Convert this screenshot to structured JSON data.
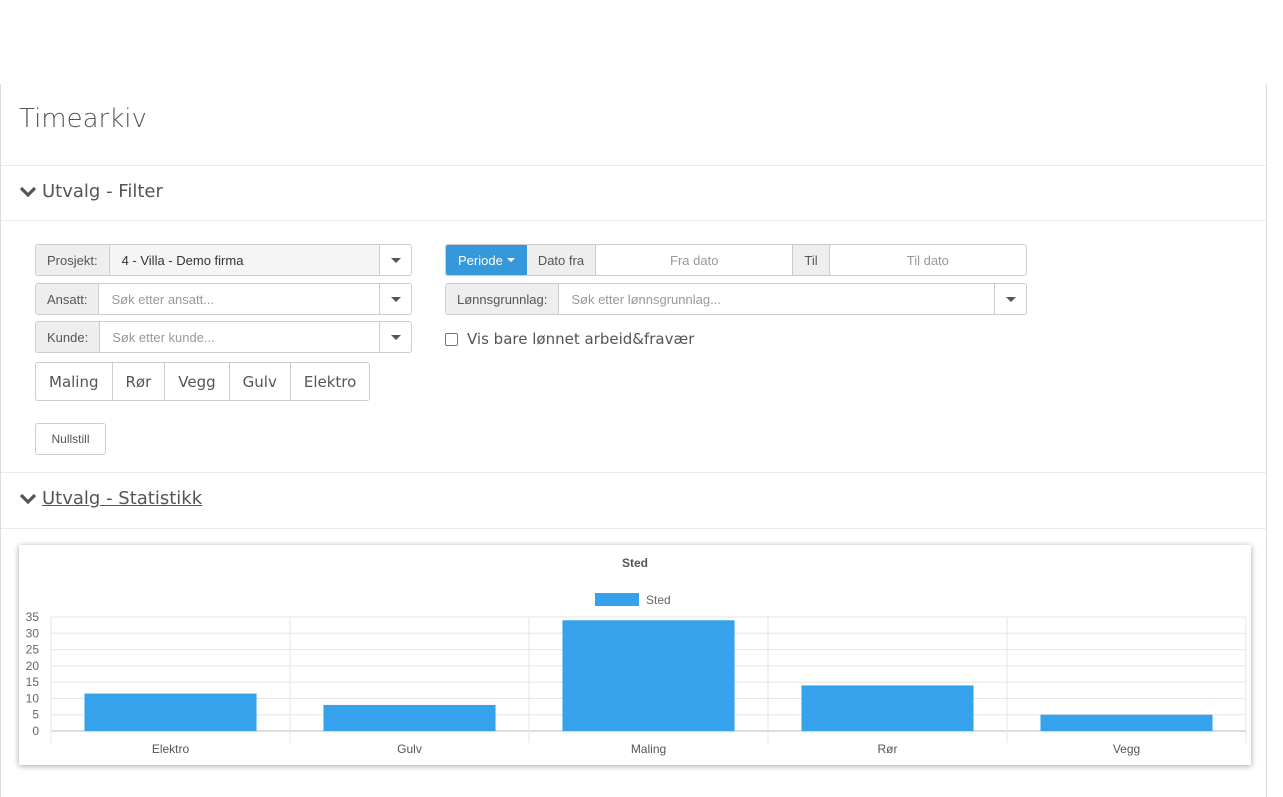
{
  "page": {
    "title": "Timearkiv"
  },
  "sections": {
    "filter": {
      "label": "Utvalg - Filter"
    },
    "stats": {
      "label": "Utvalg - Statistikk"
    }
  },
  "filters": {
    "prosjekt": {
      "label": "Prosjekt:",
      "value": "4 - Villa - Demo firma"
    },
    "ansatt": {
      "label": "Ansatt:",
      "placeholder": "Søk etter ansatt..."
    },
    "kunde": {
      "label": "Kunde:",
      "placeholder": "Søk etter kunde..."
    },
    "periode": {
      "button": "Periode",
      "from_label": "Dato fra",
      "from_placeholder": "Fra dato",
      "to_label": "Til",
      "to_placeholder": "Til dato"
    },
    "lonnsgrunnlag": {
      "label": "Lønnsgrunnlag:",
      "placeholder": "Søk etter lønnsgrunnlag..."
    },
    "paid_only": {
      "label": "Vis bare lønnet arbeid&fravær",
      "checked": false
    },
    "categories": [
      "Maling",
      "Rør",
      "Vegg",
      "Gulv",
      "Elektro"
    ],
    "reset": "Nullstill"
  },
  "colors": {
    "accent": "#3498db",
    "bar": "#36a2eb"
  },
  "chart_data": {
    "type": "bar",
    "title": "Sted",
    "categories": [
      "Elektro",
      "Gulv",
      "Maling",
      "Rør",
      "Vegg"
    ],
    "series": [
      {
        "name": "Sted",
        "values": [
          11.5,
          8,
          34,
          14,
          5
        ]
      }
    ],
    "ylim": [
      0,
      35
    ],
    "yticks": [
      "35",
      "30",
      "25",
      "20",
      "15",
      "10",
      "5",
      "0"
    ],
    "grid": true,
    "legend": "top"
  }
}
